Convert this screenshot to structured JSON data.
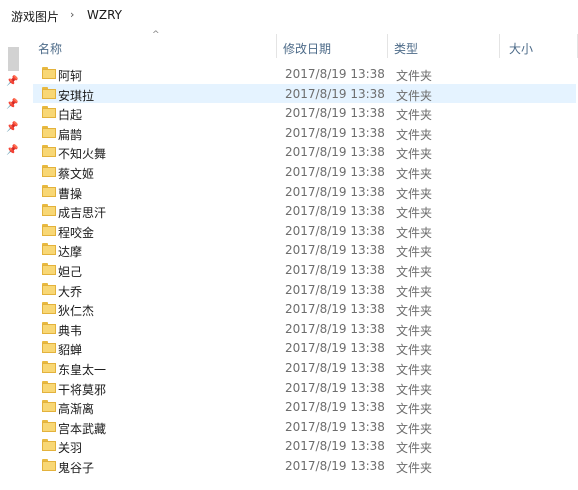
{
  "breadcrumb": {
    "items": [
      "游戏图片",
      "WZRY"
    ],
    "separator": "›"
  },
  "columns": {
    "name": "名称",
    "modified": "修改日期",
    "type": "类型",
    "size": "大小"
  },
  "sort": {
    "column": "name",
    "indicator": "^"
  },
  "files": [
    {
      "name": "阿轲",
      "date": "2017/8/19 13:38",
      "type": "文件夹"
    },
    {
      "name": "安琪拉",
      "date": "2017/8/19 13:38",
      "type": "文件夹"
    },
    {
      "name": "白起",
      "date": "2017/8/19 13:38",
      "type": "文件夹"
    },
    {
      "name": "扁鹊",
      "date": "2017/8/19 13:38",
      "type": "文件夹"
    },
    {
      "name": "不知火舞",
      "date": "2017/8/19 13:38",
      "type": "文件夹"
    },
    {
      "name": "蔡文姬",
      "date": "2017/8/19 13:38",
      "type": "文件夹"
    },
    {
      "name": "曹操",
      "date": "2017/8/19 13:38",
      "type": "文件夹"
    },
    {
      "name": "成吉思汗",
      "date": "2017/8/19 13:38",
      "type": "文件夹"
    },
    {
      "name": "程咬金",
      "date": "2017/8/19 13:38",
      "type": "文件夹"
    },
    {
      "name": "达摩",
      "date": "2017/8/19 13:38",
      "type": "文件夹"
    },
    {
      "name": "妲己",
      "date": "2017/8/19 13:38",
      "type": "文件夹"
    },
    {
      "name": "大乔",
      "date": "2017/8/19 13:38",
      "type": "文件夹"
    },
    {
      "name": "狄仁杰",
      "date": "2017/8/19 13:38",
      "type": "文件夹"
    },
    {
      "name": "典韦",
      "date": "2017/8/19 13:38",
      "type": "文件夹"
    },
    {
      "name": "貂蝉",
      "date": "2017/8/19 13:38",
      "type": "文件夹"
    },
    {
      "name": "东皇太一",
      "date": "2017/8/19 13:38",
      "type": "文件夹"
    },
    {
      "name": "干将莫邪",
      "date": "2017/8/19 13:38",
      "type": "文件夹"
    },
    {
      "name": "高渐离",
      "date": "2017/8/19 13:38",
      "type": "文件夹"
    },
    {
      "name": "宫本武藏",
      "date": "2017/8/19 13:38",
      "type": "文件夹"
    },
    {
      "name": "关羽",
      "date": "2017/8/19 13:38",
      "type": "文件夹"
    },
    {
      "name": "鬼谷子",
      "date": "2017/8/19 13:38",
      "type": "文件夹"
    }
  ],
  "selected_index": 1,
  "icons": {
    "folder": "folder-icon",
    "pin": "pin-icon",
    "sort": "sort-ascending-icon"
  },
  "colors": {
    "selection": "#e5f3ff",
    "header_text": "#4d6b89",
    "folder": "#f8d775"
  }
}
